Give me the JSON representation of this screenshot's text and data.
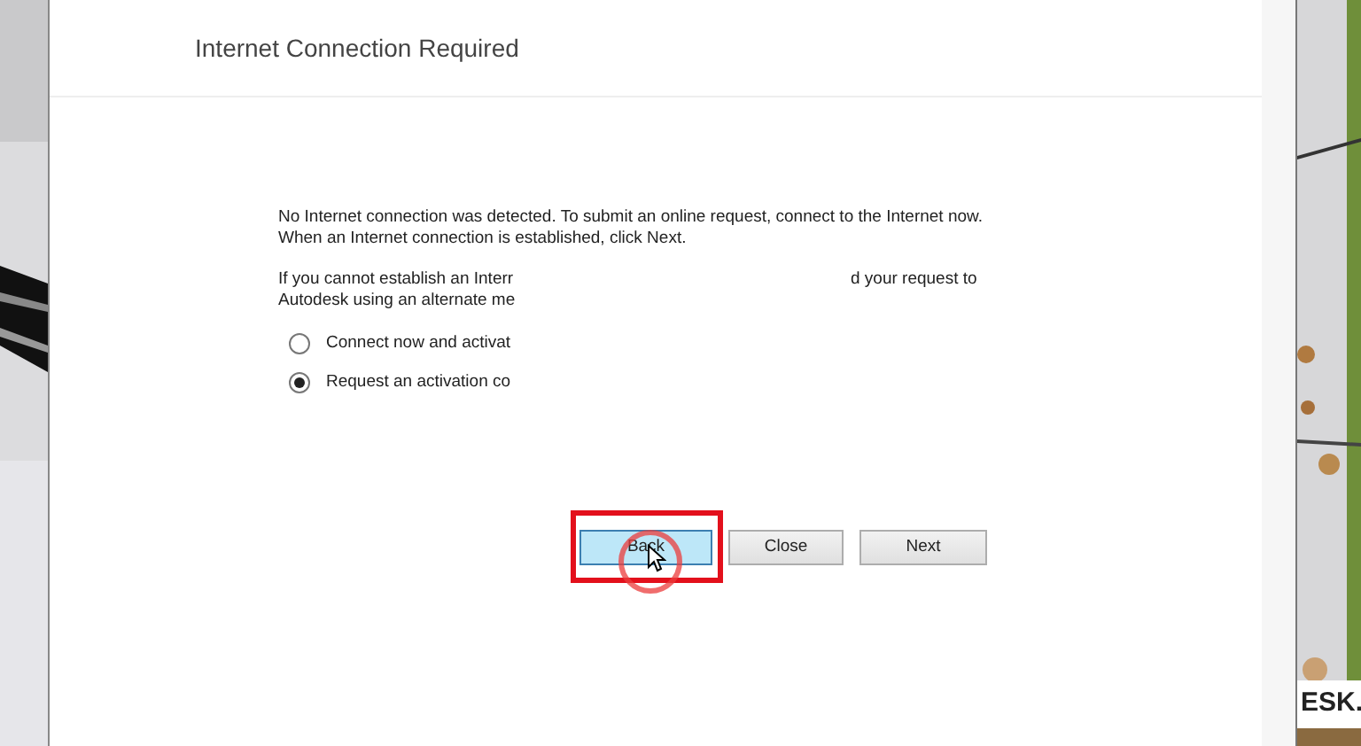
{
  "dialog": {
    "title": "Internet Connection Required",
    "message": [
      "No Internet connection was detected. To submit an online request, connect to the Internet now.",
      "When an Internet connection is established, click Next."
    ],
    "partial_left": [
      "If you cannot establish an Interr",
      "Autodesk using an alternate me"
    ],
    "partial_right": [
      "d your request to"
    ],
    "options": [
      {
        "label": "Connect now and activat",
        "selected": false
      },
      {
        "label": "Request an activation co",
        "selected": true
      }
    ],
    "buttons": [
      {
        "label": "Back",
        "hover": true,
        "annotated": true
      },
      {
        "label": "Close",
        "hover": false,
        "annotated": false
      },
      {
        "label": "Next",
        "hover": false,
        "annotated": false
      }
    ]
  },
  "logo": "ESK."
}
